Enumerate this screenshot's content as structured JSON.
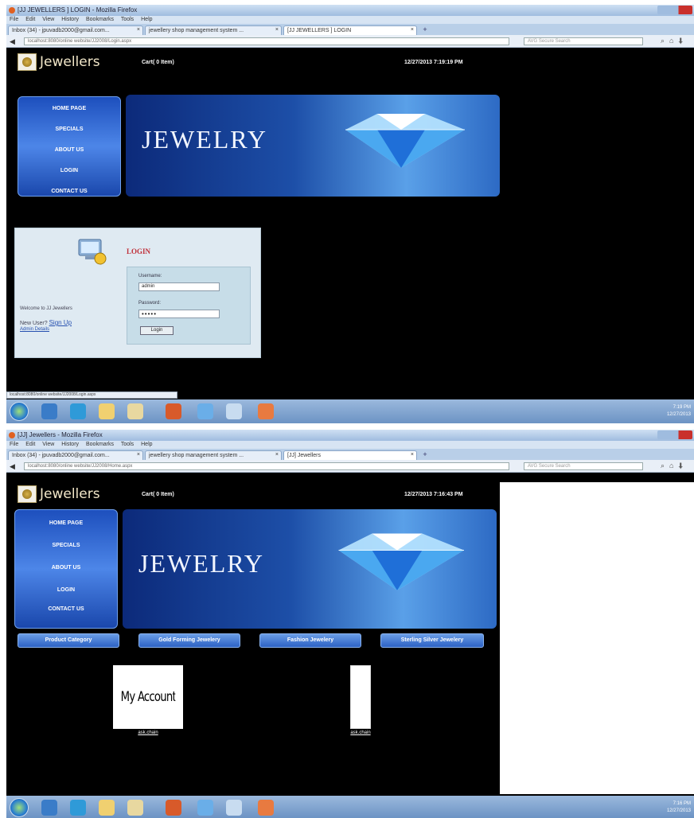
{
  "screen1": {
    "browser": {
      "window_title": "[JJ JEWELLERS ] LOGIN - Mozilla Firefox",
      "menu": [
        "File",
        "Edit",
        "View",
        "History",
        "Bookmarks",
        "Tools",
        "Help"
      ],
      "tabs": [
        "Inbox (34) - jpuvadb2000@gmail.com...",
        "jewellery shop management system ...",
        "[JJ JEWELLERS ] LOGIN"
      ],
      "url": "localhost:8080/online website/JJ2008/Login.aspx",
      "search_placeholder": "AVG Secure Search"
    },
    "site": {
      "brand": "Jewellers",
      "cart": "Cart( 0 Item)",
      "datetime": "12/27/2013 7:19:19 PM",
      "nav": [
        "HOME PAGE",
        "SPECIALS",
        "ABOUT US",
        "LOGIN",
        "CONTACT US"
      ],
      "banner": "JEWELRY"
    },
    "login": {
      "heading": "LOGIN",
      "welcome": "Welcome to JJ Jewellers",
      "new_user": "New User?",
      "signup": "Sign Up",
      "admin_link": "Admin Details",
      "username_label": "Username:",
      "username_value": "admin",
      "password_label": "Password:",
      "password_value": "•••••",
      "login_button": "Login"
    },
    "status_url": "localhost:8080/online website/JJ2008/Login.aspx",
    "tray": {
      "time": "7:19 PM",
      "date": "12/27/2013"
    }
  },
  "screen2": {
    "browser": {
      "window_title": "[JJ] Jewellers - Mozilla Firefox",
      "menu": [
        "File",
        "Edit",
        "View",
        "History",
        "Bookmarks",
        "Tools",
        "Help"
      ],
      "tabs": [
        "Inbox (34) - jpuvadb2000@gmail.com...",
        "jewellery shop management system ...",
        "[JJ] Jewellers"
      ],
      "url": "localhost:8080/online website/JJ2008/Home.aspx",
      "search_placeholder": "AVG Secure Search"
    },
    "site": {
      "brand": "Jewellers",
      "cart": "Cart( 0 Item)",
      "datetime": "12/27/2013 7:16:43 PM",
      "nav": [
        "HOME PAGE",
        "SPECIALS",
        "ABOUT US",
        "LOGIN",
        "CONTACT US"
      ],
      "banner": "JEWELRY"
    },
    "categories": [
      "Product Category",
      "Gold Forming Jewelery",
      "Fashion Jewelery",
      "Sterling Silver Jewelery"
    ],
    "products": [
      {
        "image_text": "My Account",
        "link": "ask.chain"
      },
      {
        "image_text": "",
        "link": "ask.chain"
      }
    ],
    "tray": {
      "time": "7:16 PM",
      "date": "12/27/2013"
    }
  }
}
